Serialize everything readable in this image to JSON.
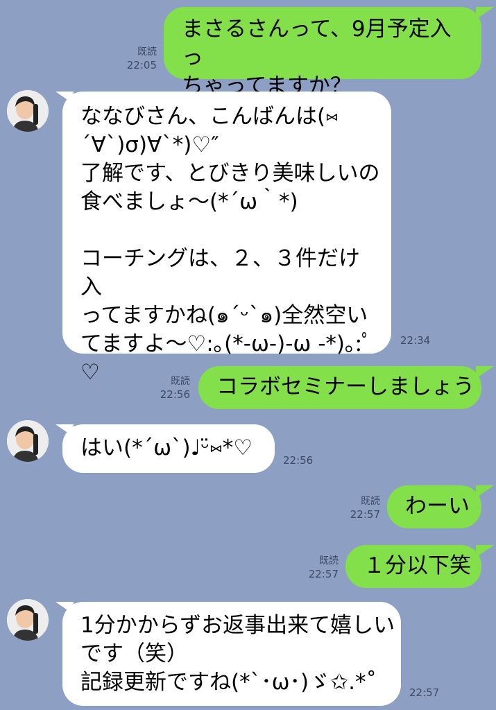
{
  "colors": {
    "background": "#8d9fc3",
    "outgoing_bubble": "#84e04a",
    "incoming_bubble": "#ffffff"
  },
  "avatar_icon": "user-avatar-photo",
  "messages": [
    {
      "dir": "out",
      "text": "まさるさんって、9月予定入っ\nちゃってますか？",
      "read": "既読",
      "time": "22:05"
    },
    {
      "dir": "in",
      "text": "ななびさん、こんばんは(⑅\n´∀`)σ)∀`*)♡″\n了解です、とびきり美味しいの\n食べましょ〜(*´ω｀*)\n\nコーチングは、２、３件だけ入\nってますかね(๑´ᵕ`๑)全然空い\nてますよ〜♡:｡(*-ω-)-ω -*)｡:ﾟ\n♡",
      "time": "22:34"
    },
    {
      "dir": "out",
      "text": "コラボセミナーしましょう",
      "read": "既読",
      "time": "22:56"
    },
    {
      "dir": "in",
      "text": "はい(*´ω`)♩ᵕ̈⑅*♡",
      "time": "22:56"
    },
    {
      "dir": "out",
      "text": "わーい",
      "read": "既読",
      "time": "22:57"
    },
    {
      "dir": "out",
      "text": "１分以下笑",
      "read": "既読",
      "time": "22:57"
    },
    {
      "dir": "in",
      "text": "1分かからずお返事出来て嬉しい\nです（笑）\n記録更新ですね(*`･ω･)ゞ✩.*˚",
      "time": "22:57"
    }
  ]
}
